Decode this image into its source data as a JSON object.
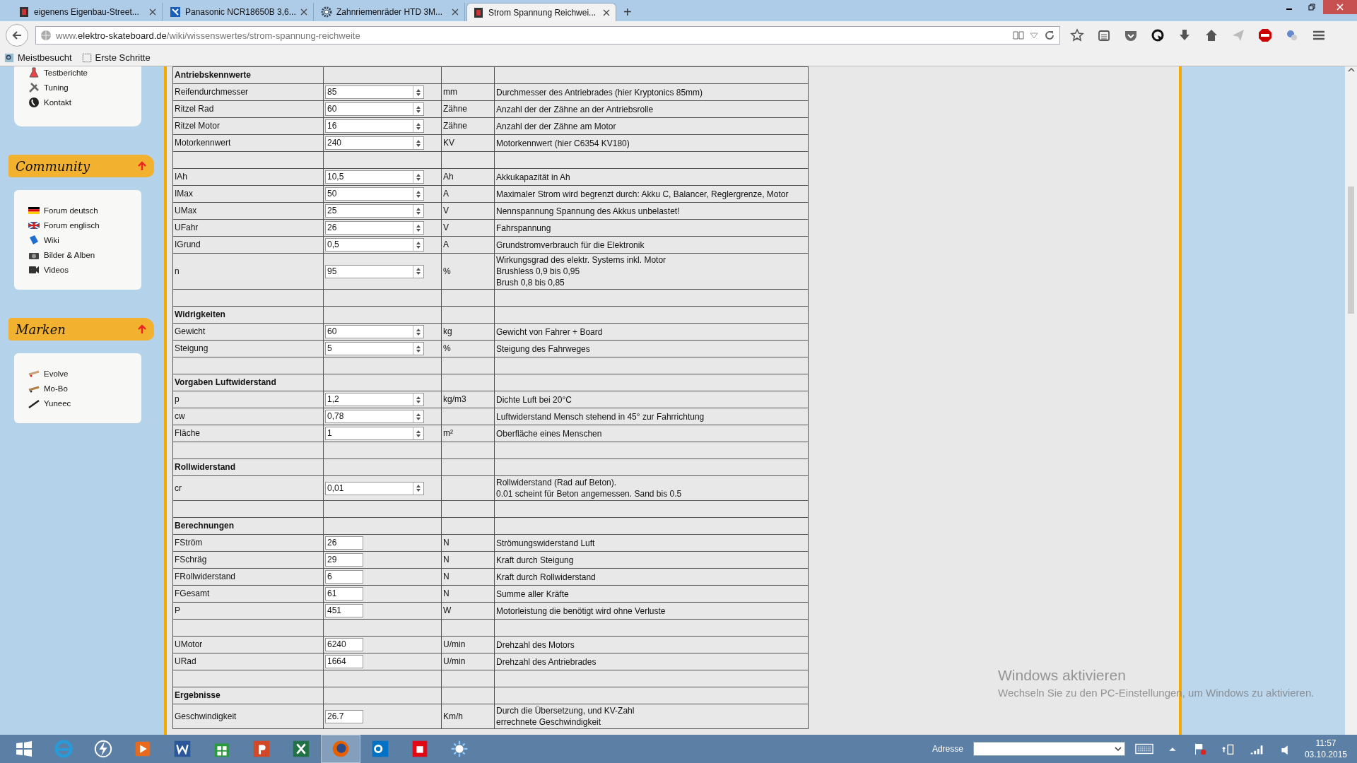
{
  "tabs": [
    {
      "title": "eigenens Eigenbau-Street...",
      "selected": false
    },
    {
      "title": "Panasonic NCR18650B 3,6...",
      "selected": false
    },
    {
      "title": "Zahnriemenräder HTD 3M...",
      "selected": false
    },
    {
      "title": "Strom Spannung Reichwei...",
      "selected": true
    }
  ],
  "new_tab": "+",
  "address": {
    "prefix": "www.",
    "domain": "elektro-skateboard.de",
    "path": "/wiki/wissenswertes/strom-spannung-reichweite"
  },
  "bookmarks": [
    "Meistbesucht",
    "Erste Schritte"
  ],
  "sidebar": {
    "top_items": [
      "Testberichte",
      "Tuning",
      "Kontakt"
    ],
    "sections": [
      {
        "title": "Community",
        "items": [
          "Forum deutsch",
          "Forum englisch",
          "Wiki",
          "Bilder & Alben",
          "Videos"
        ]
      },
      {
        "title": "Marken",
        "items": [
          "Evolve",
          "Mo-Bo",
          "Yuneec"
        ]
      }
    ]
  },
  "table": {
    "rows": [
      {
        "kind": "heading",
        "label": "Antriebskennwerte"
      },
      {
        "kind": "input",
        "label": "Reifendurchmesser",
        "value": "85",
        "unit": "mm",
        "description": [
          "Durchmesser des Antriebrades (hier Kryptonics 85mm)"
        ]
      },
      {
        "kind": "input",
        "label": "Ritzel Rad",
        "value": "60",
        "unit": "Zähne",
        "description": [
          "Anzahl der der Zähne an der Antriebsrolle"
        ]
      },
      {
        "kind": "input",
        "label": "Ritzel Motor",
        "value": "16",
        "unit": "Zähne",
        "description": [
          "Anzahl der der Zähne am Motor"
        ]
      },
      {
        "kind": "input",
        "label": "Motorkennwert",
        "value": "240",
        "unit": "KV",
        "description": [
          "Motorkennwert (hier C6354 KV180)"
        ]
      },
      {
        "kind": "blank"
      },
      {
        "kind": "input",
        "label": "IAh",
        "value": "10,5",
        "unit": "Ah",
        "description": [
          "Akkukapazität in Ah"
        ]
      },
      {
        "kind": "input",
        "label": "IMax",
        "value": "50",
        "unit": "A",
        "description": [
          "Maximaler Strom wird begrenzt durch: Akku C, Balancer, Reglergrenze, Motor"
        ]
      },
      {
        "kind": "input",
        "label": "UMax",
        "value": "25",
        "unit": "V",
        "description": [
          "Nennspannung Spannung des Akkus unbelastet!"
        ]
      },
      {
        "kind": "input",
        "label": "UFahr",
        "value": "26",
        "unit": "V",
        "description": [
          "Fahrspannung"
        ]
      },
      {
        "kind": "input",
        "label": "IGrund",
        "value": "0,5",
        "unit": "A",
        "description": [
          "Grundstromverbrauch für die Elektronik"
        ]
      },
      {
        "kind": "input",
        "label": "n",
        "value": "95",
        "unit": "%",
        "description": [
          "Wirkungsgrad des elektr. Systems inkl. Motor",
          "Brushless 0,9 bis 0,95",
          "Brush 0,8 bis 0,85"
        ]
      },
      {
        "kind": "blank"
      },
      {
        "kind": "heading",
        "label": "Widrigkeiten"
      },
      {
        "kind": "input",
        "label": "Gewicht",
        "value": "60",
        "unit": "kg",
        "description": [
          "Gewicht von Fahrer + Board"
        ]
      },
      {
        "kind": "input",
        "label": "Steigung",
        "value": "5",
        "unit": "%",
        "description": [
          "Steigung des Fahrweges"
        ]
      },
      {
        "kind": "blank"
      },
      {
        "kind": "heading",
        "label": "Vorgaben Luftwiderstand"
      },
      {
        "kind": "input",
        "label": "p",
        "value": "1,2",
        "unit": "kg/m3",
        "description": [
          "Dichte Luft bei 20°C"
        ]
      },
      {
        "kind": "input",
        "label": "cw",
        "value": "0,78",
        "description": [
          "Luftwiderstand Mensch stehend in 45° zur Fahrrichtung"
        ]
      },
      {
        "kind": "input",
        "label": "Fläche",
        "value": "1",
        "unit": "m²",
        "description": [
          "Oberfläche eines Menschen"
        ]
      },
      {
        "kind": "blank"
      },
      {
        "kind": "heading",
        "label": "Rollwiderstand"
      },
      {
        "kind": "input",
        "label": "cr",
        "value": "0,01",
        "description": [
          "Rollwiderstand (Rad auf Beton).",
          "0.01 scheint für Beton angemessen. Sand bis 0.5"
        ]
      },
      {
        "kind": "blank"
      },
      {
        "kind": "heading",
        "label": "Berechnungen"
      },
      {
        "kind": "output",
        "label": "FStröm",
        "value": "26",
        "unit": "N",
        "description": [
          "Strömungswiderstand Luft"
        ]
      },
      {
        "kind": "output",
        "label": "FSchräg",
        "value": "29",
        "unit": "N",
        "description": [
          "Kraft durch Steigung"
        ]
      },
      {
        "kind": "output",
        "label": "FRollwiderstand",
        "value": "6",
        "unit": "N",
        "description": [
          "Kraft durch Rollwiderstand"
        ]
      },
      {
        "kind": "output",
        "label": "FGesamt",
        "value": "61",
        "unit": "N",
        "description": [
          "Summe aller Kräfte"
        ]
      },
      {
        "kind": "output",
        "label": "P",
        "value": "451",
        "unit": "W",
        "description": [
          "Motorleistung die benötigt wird ohne Verluste"
        ]
      },
      {
        "kind": "blank"
      },
      {
        "kind": "output",
        "label": "UMotor",
        "value": "6240",
        "unit": "U/min",
        "description": [
          "Drehzahl des Motors"
        ]
      },
      {
        "kind": "output",
        "label": "URad",
        "value": "1664",
        "unit": "U/min",
        "description": [
          "Drehzahl des Antriebrades"
        ]
      },
      {
        "kind": "blank"
      },
      {
        "kind": "heading",
        "label": "Ergebnisse"
      },
      {
        "kind": "output",
        "label": "Geschwindigkeit",
        "value": "26.7",
        "unit": "Km/h",
        "description": [
          "Durch die Übersetzung, und KV-Zahl",
          "errechnete Geschwindigkeit"
        ]
      }
    ]
  },
  "activation": {
    "title": "Windows aktivieren",
    "text": "Wechseln Sie zu den PC-Einstellungen, um Windows zu aktivieren."
  },
  "taskbar": {
    "apps": [
      {
        "active": false
      },
      {
        "active": false
      },
      {
        "active": false
      },
      {
        "active": false
      },
      {
        "active": false
      },
      {
        "active": false
      },
      {
        "active": false
      },
      {
        "active": true
      },
      {
        "active": false
      },
      {
        "active": false
      },
      {
        "active": false
      }
    ],
    "address_label": "Adresse",
    "time": "11:57",
    "date": "03.10.2015"
  }
}
